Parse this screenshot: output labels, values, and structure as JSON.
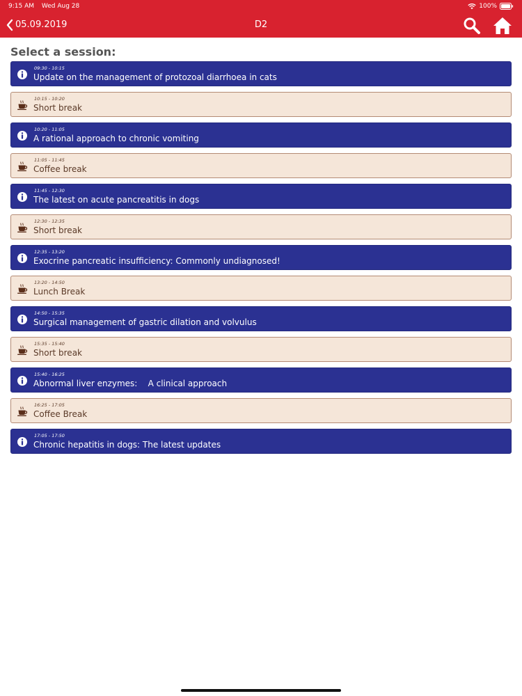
{
  "status_bar": {
    "time": "9:15 AM",
    "date": "Wed Aug 28",
    "battery": "100%"
  },
  "nav": {
    "back_label": "05.09.2019",
    "title": "D2",
    "search_icon": "search-icon",
    "home_icon": "home-icon"
  },
  "heading": "Select a session:",
  "colors": {
    "bar": "#d8222f",
    "talk": "#2b3192",
    "break": "#f5e6d9",
    "break_border": "#b38a74"
  },
  "sessions": [
    {
      "type": "talk",
      "time": "09:30 - 10:15",
      "title": "Update on the management of protozoal diarrhoea in cats"
    },
    {
      "type": "break",
      "time": "10:15 - 10:20",
      "title": "Short break"
    },
    {
      "type": "talk",
      "time": "10:20 - 11:05",
      "title": "A rational approach to chronic vomiting"
    },
    {
      "type": "break",
      "time": "11:05 - 11:45",
      "title": "Coffee break"
    },
    {
      "type": "talk",
      "time": "11:45 - 12:30",
      "title": "The latest on acute pancreatitis in dogs"
    },
    {
      "type": "break",
      "time": "12:30 - 12:35",
      "title": "Short break"
    },
    {
      "type": "talk",
      "time": "12:35 - 13:20",
      "title": "Exocrine pancreatic insufficiency: Commonly undiagnosed!"
    },
    {
      "type": "break",
      "time": "13:20 - 14:50",
      "title": "Lunch Break"
    },
    {
      "type": "talk",
      "time": "14:50 - 15:35",
      "title": "Surgical management of gastric dilation and volvulus"
    },
    {
      "type": "break",
      "time": "15:35 - 15:40",
      "title": "Short break"
    },
    {
      "type": "talk",
      "time": "15:40 - 16:25",
      "title": "Abnormal liver enzymes:    A clinical approach"
    },
    {
      "type": "break",
      "time": "16:25 - 17:05",
      "title": "Coffee Break"
    },
    {
      "type": "talk",
      "time": "17:05 - 17:50",
      "title": "Chronic hepatitis in dogs: The latest updates"
    }
  ]
}
